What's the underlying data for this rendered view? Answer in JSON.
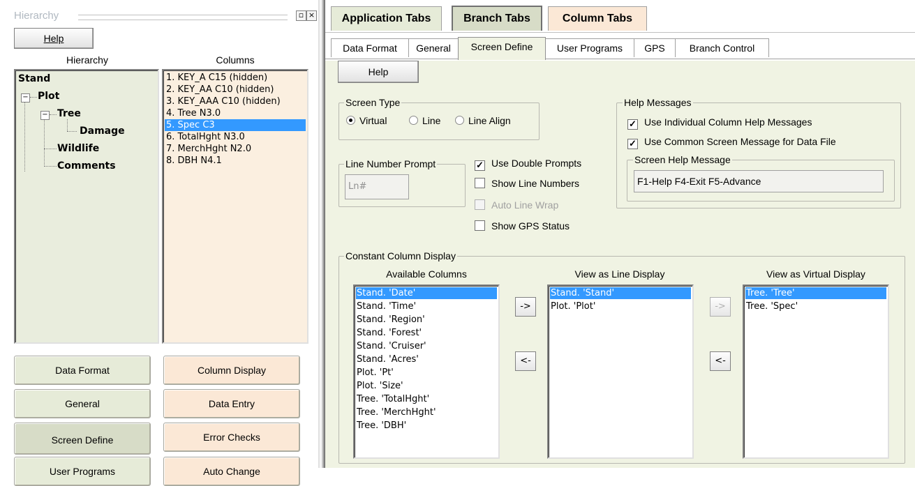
{
  "left_panel": {
    "title": "Hierarchy",
    "title_controls": [
      "▫",
      "×"
    ],
    "help_button": "Help",
    "hierarchy_header": "Hierarchy",
    "columns_header": "Columns",
    "tree": [
      {
        "label": "Stand",
        "level": 0
      },
      {
        "label": "Plot",
        "level": 1
      },
      {
        "label": "Tree",
        "level": 2
      },
      {
        "label": "Damage",
        "level": 3
      },
      {
        "label": "Wildlife",
        "level": 2
      },
      {
        "label": "Comments",
        "level": 2
      }
    ],
    "columns": [
      "1. KEY_A C15 (hidden)",
      "2. KEY_AA C10 (hidden)",
      "3. KEY_AAA C10 (hidden)",
      "4. Tree N3.0",
      "5. Spec C3",
      "6. TotalHght N3.0",
      "7. MerchHght N2.0",
      "8. DBH N4.1"
    ],
    "selected_column_index": 4,
    "buttons_left": [
      "Data Format",
      "General",
      "Screen Define",
      "User Programs"
    ],
    "buttons_right": [
      "Column Display",
      "Data Entry",
      "Error Checks",
      "Auto Change"
    ]
  },
  "app_tabs": [
    "Application Tabs",
    "Branch Tabs",
    "Column Tabs"
  ],
  "sub_tabs": [
    "Data Format",
    "General",
    "Screen Define",
    "User Programs",
    "GPS",
    "Branch Control"
  ],
  "active_sub_tab": "Screen Define",
  "help_button": "Help",
  "screen_type": {
    "label": "Screen Type",
    "options": [
      "Virtual",
      "Line",
      "Line Align"
    ],
    "selected": "Virtual"
  },
  "line_number_prompt": {
    "label": "Line Number Prompt",
    "value": "Ln#"
  },
  "checkboxes": [
    {
      "label": "Use Double Prompts",
      "checked": true,
      "enabled": true
    },
    {
      "label": "Show Line Numbers",
      "checked": false,
      "enabled": true
    },
    {
      "label": "Auto Line Wrap",
      "checked": false,
      "enabled": false
    },
    {
      "label": "Show GPS Status",
      "checked": false,
      "enabled": true
    }
  ],
  "help_messages": {
    "label": "Help Messages",
    "options": [
      {
        "label": "Use Individual Column Help Messages",
        "checked": true
      },
      {
        "label": "Use Common Screen Message for Data File",
        "checked": true
      }
    ],
    "screen_help_label": "Screen Help Message",
    "screen_help_value": "F1-Help F4-Exit F5-Advance"
  },
  "constant_display": {
    "label": "Constant Column Display",
    "available_header": "Available Columns",
    "line_header": "View as Line Display",
    "virtual_header": "View as Virtual Display",
    "available": [
      "Stand. 'Date'",
      "Stand. 'Time'",
      "Stand. 'Region'",
      "Stand. 'Forest'",
      "Stand. 'Cruiser'",
      "Stand. 'Acres'",
      "Plot. 'Pt'",
      "Plot. 'Size'",
      "Tree. 'TotalHght'",
      "Tree. 'MerchHght'",
      "Tree. 'DBH'"
    ],
    "line": [
      "Stand. 'Stand'",
      "Plot. 'Plot'"
    ],
    "virtual": [
      "Tree. 'Tree'",
      "Tree. 'Spec'"
    ],
    "arrow_right": "->",
    "arrow_left": "<-"
  }
}
